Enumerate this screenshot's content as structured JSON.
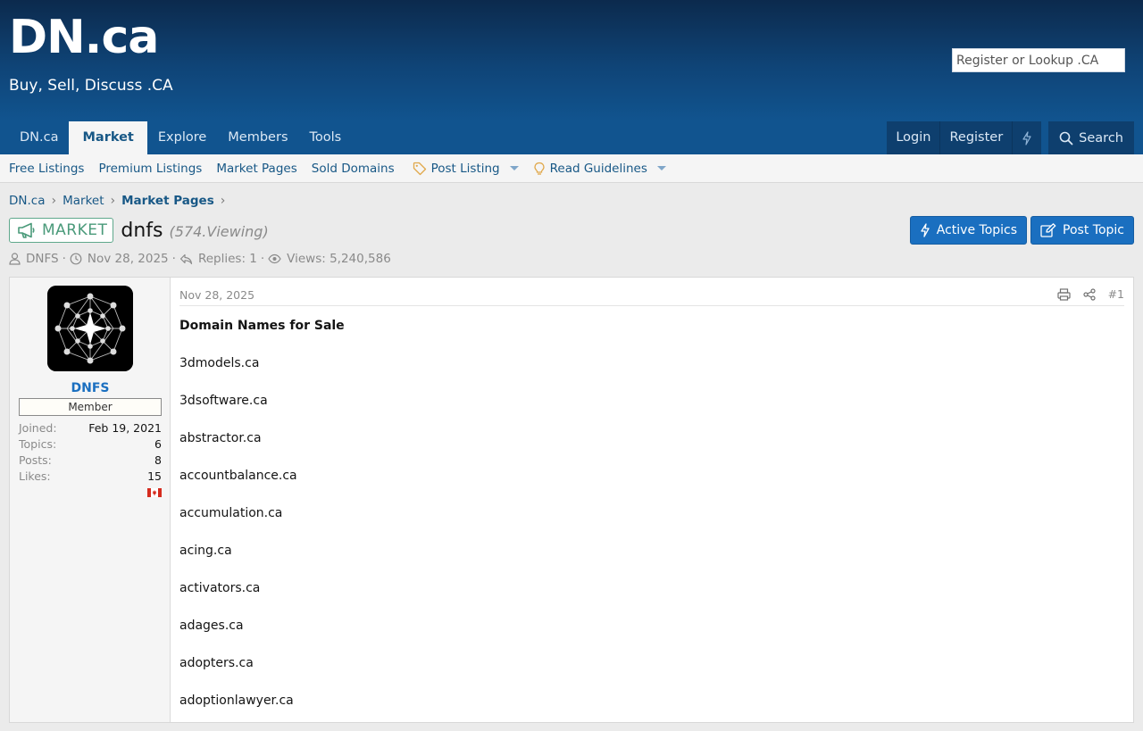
{
  "site": {
    "logo": "DN.ca",
    "tagline": "Buy, Sell, Discuss .CA",
    "lookup_placeholder": "Register or Lookup .CA"
  },
  "nav": {
    "tabs": [
      "DN.ca",
      "Market",
      "Explore",
      "Members",
      "Tools"
    ],
    "active_tab": "Market",
    "login": "Login",
    "register": "Register",
    "search": "Search"
  },
  "subnav": {
    "items": [
      "Free Listings",
      "Premium Listings",
      "Market Pages",
      "Sold Domains"
    ],
    "post_listing": "Post Listing",
    "read_guidelines": "Read Guidelines"
  },
  "breadcrumb": [
    "DN.ca",
    "Market",
    "Market Pages"
  ],
  "thread": {
    "prefix": "MARKET",
    "title": "dnfs",
    "viewing": "(574.Viewing)",
    "author": "DNFS",
    "date": "Nov 28, 2025",
    "replies": "Replies: 1",
    "views": "Views: 5,240,586"
  },
  "actions": {
    "active_topics": "Active Topics",
    "post_topic": "Post Topic"
  },
  "post": {
    "username": "DNFS",
    "user_title": "Member",
    "extras": [
      {
        "label": "Joined:",
        "value": "Feb 19, 2021"
      },
      {
        "label": "Topics:",
        "value": "6"
      },
      {
        "label": "Posts:",
        "value": "8"
      },
      {
        "label": "Likes:",
        "value": "15"
      }
    ],
    "date": "Nov 28, 2025",
    "number": "#1",
    "heading": "Domain Names for Sale",
    "domains": [
      "3dmodels.ca",
      "3dsoftware.ca",
      "abstractor.ca",
      "accountbalance.ca",
      "accumulation.ca",
      "acing.ca",
      "activators.ca",
      "adages.ca",
      "adopters.ca",
      "adoptionlawyer.ca"
    ]
  },
  "colors": {
    "header_dark": "#0c2a4d",
    "header_blue": "#11548f",
    "link": "#185886",
    "button": "#1a6fc0",
    "market_green": "#4a9a7a"
  }
}
